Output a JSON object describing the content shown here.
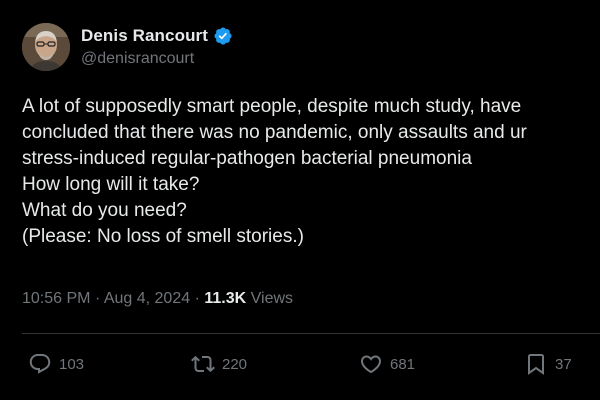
{
  "author": {
    "display_name": "Denis Rancourt",
    "handle": "@denisrancourt",
    "verified": true,
    "avatar_icon": "profile-photo"
  },
  "tweet": {
    "lines": [
      "A lot of supposedly smart people, despite much study, have",
      "concluded that there was no pandemic, only assaults and ur",
      "stress-induced regular-pathogen bacterial pneumonia",
      "How long will it take?",
      "What do you need?",
      "(Please: No loss of smell stories.)"
    ],
    "time": "10:56 PM",
    "separator": "·",
    "date": "Aug 4, 2024",
    "views_count": "11.3K",
    "views_label": "Views"
  },
  "actions": {
    "reply": {
      "icon": "reply-icon",
      "count": "103"
    },
    "retweet": {
      "icon": "retweet-icon",
      "count": "220"
    },
    "like": {
      "icon": "heart-icon",
      "count": "681"
    },
    "bookmark": {
      "icon": "bookmark-icon",
      "count": "37"
    }
  },
  "colors": {
    "background": "#000000",
    "text_primary": "#e7e9ea",
    "text_secondary": "#71767b",
    "verified_badge": "#1d9bf0",
    "divider": "#2f3336"
  }
}
